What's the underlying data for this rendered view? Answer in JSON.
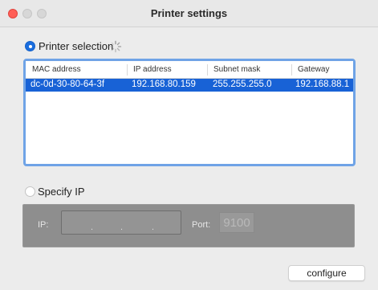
{
  "window": {
    "title": "Printer settings"
  },
  "printer_selection": {
    "label": "Printer selection",
    "selected": true,
    "table": {
      "columns": [
        "MAC address",
        "IP address",
        "Subnet mask",
        "Gateway"
      ],
      "rows": [
        [
          "dc-0d-30-80-64-3f",
          "192.168.80.159",
          "255.255.255.0",
          "192.168.88.1"
        ]
      ],
      "selected_row": 0
    }
  },
  "specify_ip": {
    "label": "Specify IP",
    "selected": false,
    "ip_label": "IP:",
    "ip_separators": [
      ".",
      ".",
      "."
    ],
    "port_label": "Port:",
    "port_value": "9100"
  },
  "actions": {
    "configure_label": "configure"
  },
  "colors": {
    "accent": "#1a6dde",
    "selection": "#1862d6",
    "table_focus_ring": "#6fa3e6",
    "disabled_panel": "#8e8e8e",
    "close_button": "#ff5f57"
  }
}
